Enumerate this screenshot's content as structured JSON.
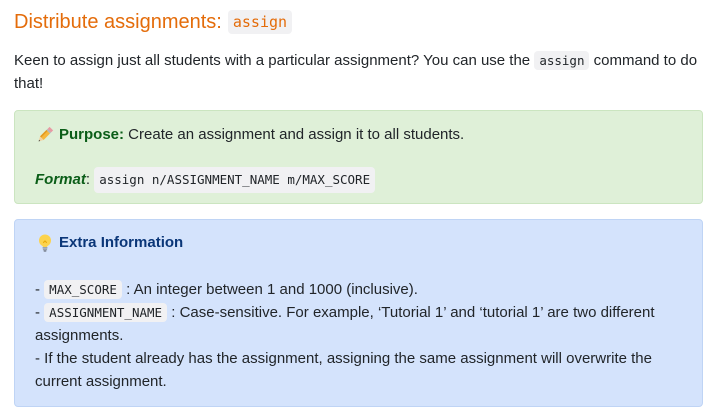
{
  "heading": {
    "text": "Distribute assignments:",
    "code": "assign"
  },
  "intro": {
    "before": "Keen to assign just all students with a particular assignment? You can use the ",
    "code": "assign",
    "after": " command to do that!"
  },
  "purpose_box": {
    "icon": "pencil-icon",
    "label": "Purpose:",
    "text": " Create an assignment and assign it to all students.",
    "format_label": "Format",
    "format_colon": ": ",
    "format_code": "assign n/ASSIGNMENT_NAME m/MAX_SCORE"
  },
  "info_box": {
    "icon": "lightbulb-icon",
    "title": "Extra Information",
    "items": [
      {
        "dash": "- ",
        "code": "MAX_SCORE",
        "text": " : An integer between 1 and 1000 (inclusive)."
      },
      {
        "dash": "- ",
        "code": "ASSIGNMENT_NAME",
        "text": " : Case-sensitive. For example, ‘Tutorial 1’ and ‘tutorial 1’ are two different assignments."
      },
      {
        "dash": "- ",
        "code": "",
        "text": "If the student already has the assignment, assigning the same assignment will overwrite the current assignment."
      }
    ]
  },
  "colors": {
    "heading": "#e46c0a",
    "green_bg": "#dff0d8",
    "green_label": "#0b5e18",
    "blue_bg": "#d4e3fc",
    "blue_label": "#0a3678"
  }
}
